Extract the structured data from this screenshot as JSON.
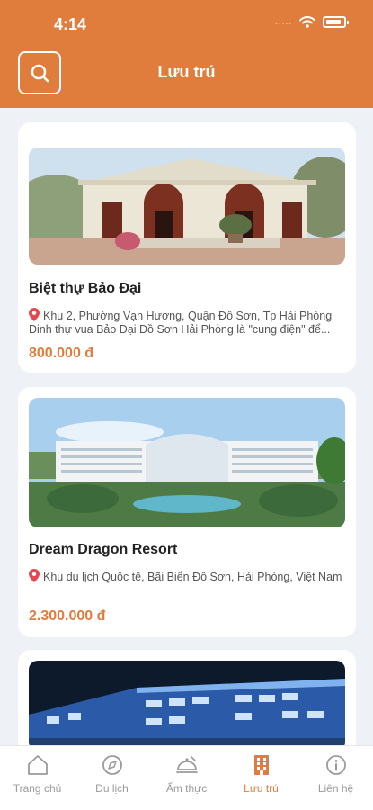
{
  "status_bar": {
    "time": "4:14",
    "signal": "....."
  },
  "header": {
    "title": "Lưu trú",
    "search_icon": "search-icon"
  },
  "listings": [
    {
      "title": "Biệt thự Bảo Đại",
      "address": "Khu 2, Phường Vạn Hương, Quận Đồ Sơn, Tp Hải Phòng",
      "description": "Dinh thự vua Bảo Đại Đồ Sơn Hải Phòng là \"cung điện\" để...",
      "price": "800.000 đ"
    },
    {
      "title": "Dream Dragon Resort",
      "address": "Khu du lịch Quốc tế, Bãi Biển Đồ Sơn, Hải Phòng, Việt Nam",
      "price": "2.300.000 đ"
    },
    {
      "title": "",
      "address": "",
      "price": ""
    }
  ],
  "tabbar": {
    "items": [
      {
        "label": "Trang chủ",
        "icon": "home-icon"
      },
      {
        "label": "Du lịch",
        "icon": "compass-icon"
      },
      {
        "label": "Ẩm thực",
        "icon": "dish-icon"
      },
      {
        "label": "Lưu trú",
        "icon": "hotel-icon",
        "active": true
      },
      {
        "label": "Liên hệ",
        "icon": "info-icon"
      }
    ]
  },
  "colors": {
    "accent": "#e07d3c",
    "background": "#eef1f6",
    "inactive": "#9b9b9b"
  }
}
